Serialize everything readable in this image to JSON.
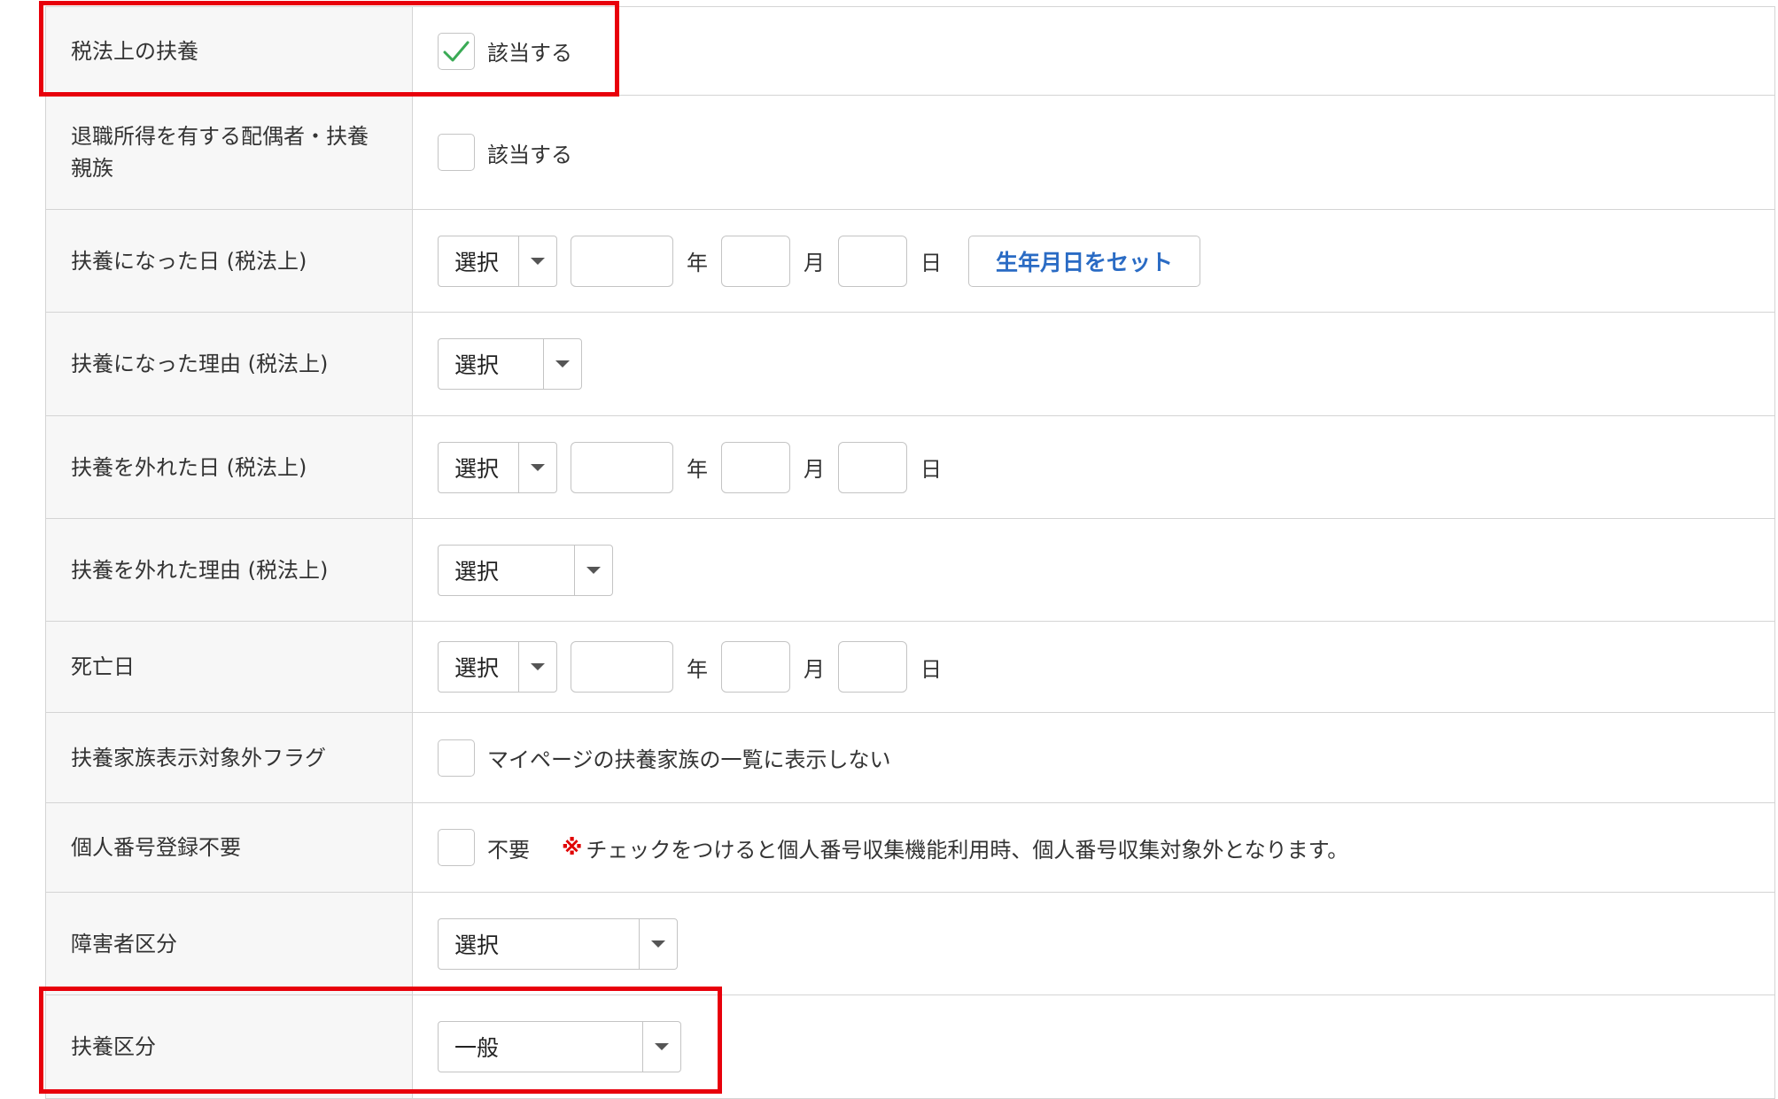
{
  "rows": {
    "tax_dependent": {
      "label": "税法上の扶養",
      "checkbox_label": "該当する",
      "checked": true
    },
    "retirement_income": {
      "label_line1": "退職所得を有する配偶者・扶養",
      "label_line2": "親族",
      "checkbox_label": "該当する",
      "checked": false
    },
    "dependent_start_date": {
      "label": "扶養になった日 (税法上)",
      "era": "選択",
      "year_unit": "年",
      "month_unit": "月",
      "day_unit": "日",
      "set_birthdate_button": "生年月日をセット"
    },
    "dependent_start_reason": {
      "label": "扶養になった理由 (税法上)",
      "value": "選択"
    },
    "dependent_end_date": {
      "label": "扶養を外れた日 (税法上)",
      "era": "選択",
      "year_unit": "年",
      "month_unit": "月",
      "day_unit": "日"
    },
    "dependent_end_reason": {
      "label": "扶養を外れた理由 (税法上)",
      "value": "選択"
    },
    "death_date": {
      "label": "死亡日",
      "era": "選択",
      "year_unit": "年",
      "month_unit": "月",
      "day_unit": "日"
    },
    "hide_flag": {
      "label": "扶養家族表示対象外フラグ",
      "checkbox_label": "マイページの扶養家族の一覧に表示しない",
      "checked": false
    },
    "my_number_not_required": {
      "label": "個人番号登録不要",
      "checkbox_label": "不要",
      "checked": false,
      "note_mark": "※",
      "note": "チェックをつけると個人番号収集機能利用時、個人番号収集対象外となります。"
    },
    "disability_category": {
      "label": "障害者区分",
      "value": "選択"
    },
    "dependent_category": {
      "label": "扶養区分",
      "value": "一般"
    }
  },
  "colors": {
    "highlight": "#e8000b",
    "check": "#3aaa55",
    "button_text": "#2a6bc4",
    "note_mark": "#e00000"
  },
  "icons": {
    "check": "check-icon",
    "dropdown": "chevron-down-icon"
  }
}
